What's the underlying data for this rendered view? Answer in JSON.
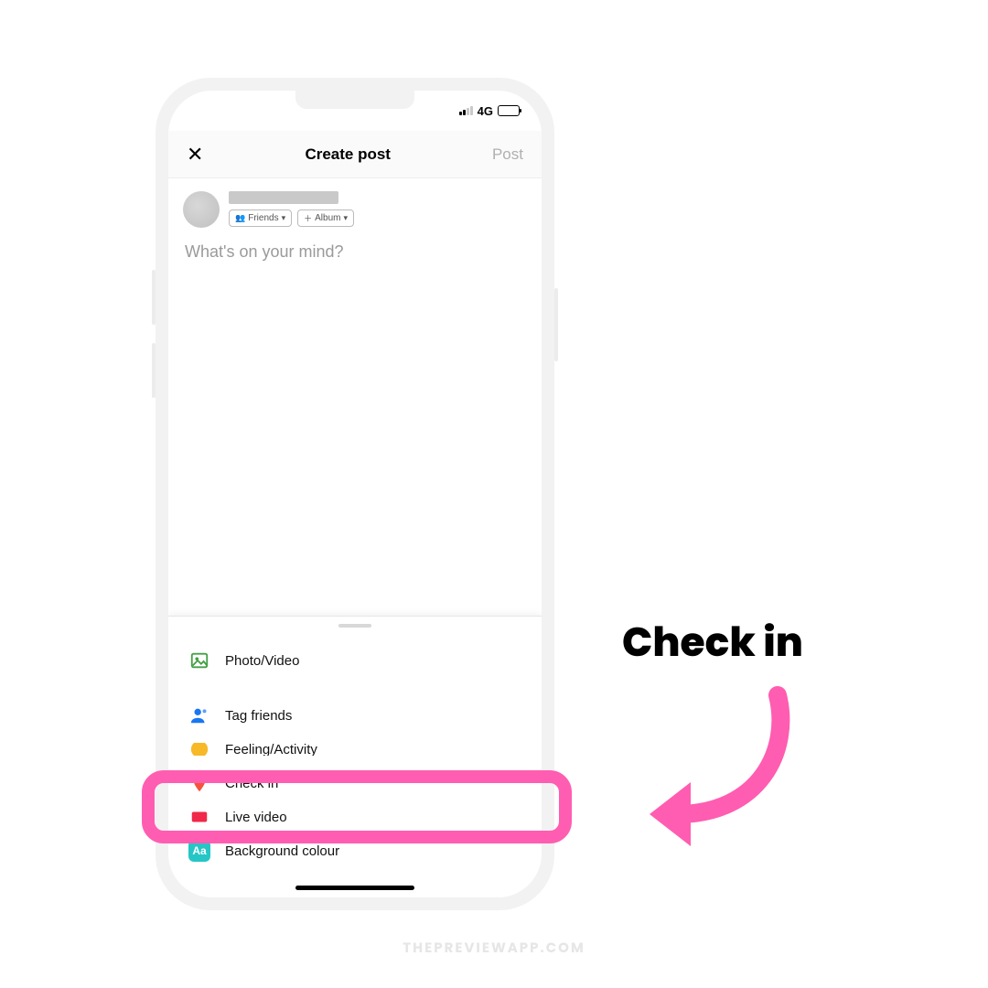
{
  "statusbar": {
    "network_label": "4G"
  },
  "header": {
    "title": "Create post",
    "post_label": "Post"
  },
  "user": {
    "audience_pill": "Friends",
    "album_pill": "Album"
  },
  "composer": {
    "placeholder": "What's on your mind?"
  },
  "options": [
    {
      "id": "photo",
      "label": "Photo/Video",
      "icon": "photo-icon"
    },
    {
      "id": "tag",
      "label": "Tag friends",
      "icon": "tag-friends-icon"
    },
    {
      "id": "feeling",
      "label": "Feeling/Activity",
      "icon": "feeling-icon"
    },
    {
      "id": "checkin",
      "label": "Check in",
      "icon": "checkin-icon"
    },
    {
      "id": "live",
      "label": "Live video",
      "icon": "live-icon"
    },
    {
      "id": "bg",
      "label": "Background colour",
      "icon": "bgcolor-icon"
    }
  ],
  "callout": {
    "title": "Check in"
  },
  "watermark": "THEPREVIEWAPP.COM",
  "colors": {
    "highlight": "#ff5db1",
    "checkin_icon": "#f5533d",
    "bg_icon": "#26c6c6",
    "photo_icon": "#43a047",
    "tag_icon": "#1877f2"
  }
}
